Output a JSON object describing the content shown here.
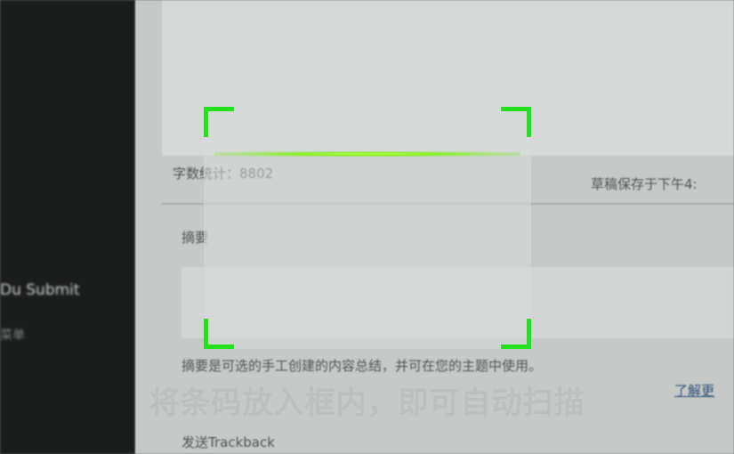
{
  "background": {
    "sidebar_items": [
      "Du Submit",
      "菜单"
    ],
    "word_count_label": "字数统计：8802",
    "draft_status": "草稿保存于下午4:",
    "excerpt_heading": "摘要",
    "excerpt_help": "摘要是可选的手工创建的内容总结，并可在您的主题中使用。",
    "learn_more_link": "了解更",
    "trackback_heading": "发送Trackback"
  },
  "scanner": {
    "hint": "将条码放入框内，即可自动扫描",
    "frame_color": "#21e21c",
    "laser_color": "#9ef53a"
  }
}
